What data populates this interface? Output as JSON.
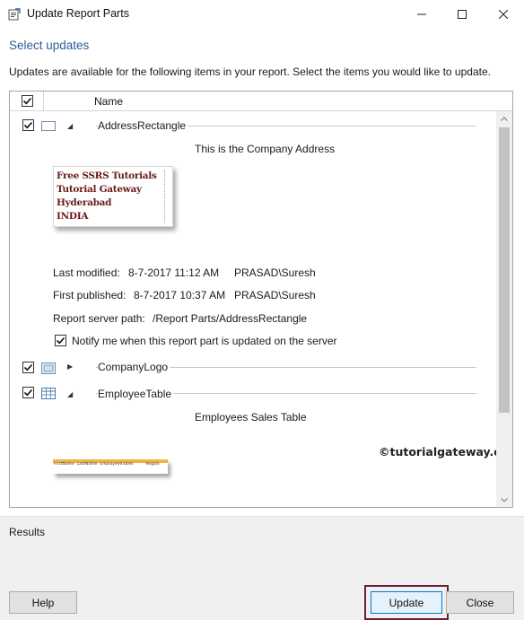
{
  "window": {
    "title": "Update Report Parts",
    "controls": {
      "minimize": "—",
      "maximize": "☐",
      "close": "✕"
    }
  },
  "heading": "Select updates",
  "description": "Updates are available for the following items in your report. Select the items you would like to update.",
  "list": {
    "header": {
      "name_label": "Name",
      "select_all_checked": true
    },
    "items": [
      {
        "name": "AddressRectangle",
        "checked": true,
        "expanded": true,
        "icon": "rectangle-icon",
        "caption": "This is the Company Address",
        "preview_lines": [
          "Free SSRS Tutorials",
          "Tutorial Gateway",
          "Hyderabad",
          "INDIA"
        ],
        "last_modified_label": "Last modified:",
        "last_modified_date": "8-7-2017 11:12 AM",
        "last_modified_user": "PRASAD\\Suresh",
        "first_published_label": "First published:",
        "first_published_date": "8-7-2017 10:37 AM",
        "first_published_user": "PRASAD\\Suresh",
        "server_path_label": "Report server path:",
        "server_path": "/Report Parts/AddressRectangle",
        "notify_label": "Notify me when this report part is updated on the server",
        "notify_checked": true
      },
      {
        "name": "CompanyLogo",
        "checked": true,
        "expanded": false,
        "icon": "image-icon"
      },
      {
        "name": "EmployeeTable",
        "checked": true,
        "expanded": true,
        "icon": "table-icon",
        "caption": "Employees Sales Table",
        "preview_cells": [
          "FirstName",
          "LastName",
          "EmployeeID",
          "Sales",
          "Region"
        ]
      }
    ]
  },
  "watermark": "©tutorialgateway.org",
  "results": {
    "label": "Results"
  },
  "buttons": {
    "help": "Help",
    "update": "Update",
    "close": "Close"
  },
  "colors": {
    "heading": "#2e5e98",
    "update_highlight": "#6b1f3a",
    "preview_text": "#6b1a1a",
    "table_band": "#f2b33c"
  }
}
